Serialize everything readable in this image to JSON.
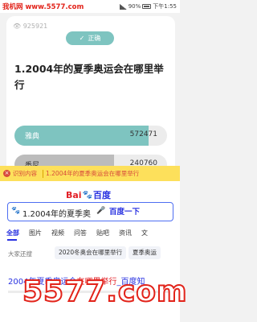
{
  "statusbar": {
    "watermark_text": "我机网 www.5577.com",
    "time": "下午1:55",
    "battery": "90%"
  },
  "question_card": {
    "question_id": "925921",
    "correct_badge": "正确",
    "question": "1.2004年的夏季奥运会在哪里举行",
    "options": [
      {
        "name": "雅典",
        "count": "572471",
        "fill_fraction": 0.88,
        "selected": true
      },
      {
        "name": "悉尼",
        "count": "240760",
        "fill_fraction": 0.65,
        "selected": false
      }
    ]
  },
  "recognition": {
    "close_label": "识别内容",
    "text": "1.2004年的夏季奥运会在哪里举行"
  },
  "baidu": {
    "logo_bai": "Bai",
    "logo_du": "百度",
    "search_query": "1.2004年的夏季奥",
    "search_button": "百度一下",
    "tabs": [
      "全部",
      "图片",
      "视频",
      "问答",
      "贴吧",
      "资讯",
      "文"
    ],
    "suggest_label": "大家还搜",
    "suggestions": [
      "2020冬奥会在哪里举行",
      "夏季奥运"
    ],
    "result_title_prefix": "2004年夏季奥运会",
    "result_title_highlight": "在哪里举行",
    "result_title_suffix": "_百度知"
  },
  "watermark_big": "5577.com",
  "colors": {
    "teal": "#7ec4c0",
    "grey_fill": "#bcbcbc",
    "baidu_blue": "#2932e1",
    "baidu_red": "#e21f26",
    "recognition_bar": "#fde05b",
    "watermark_red": "#e2231a"
  }
}
